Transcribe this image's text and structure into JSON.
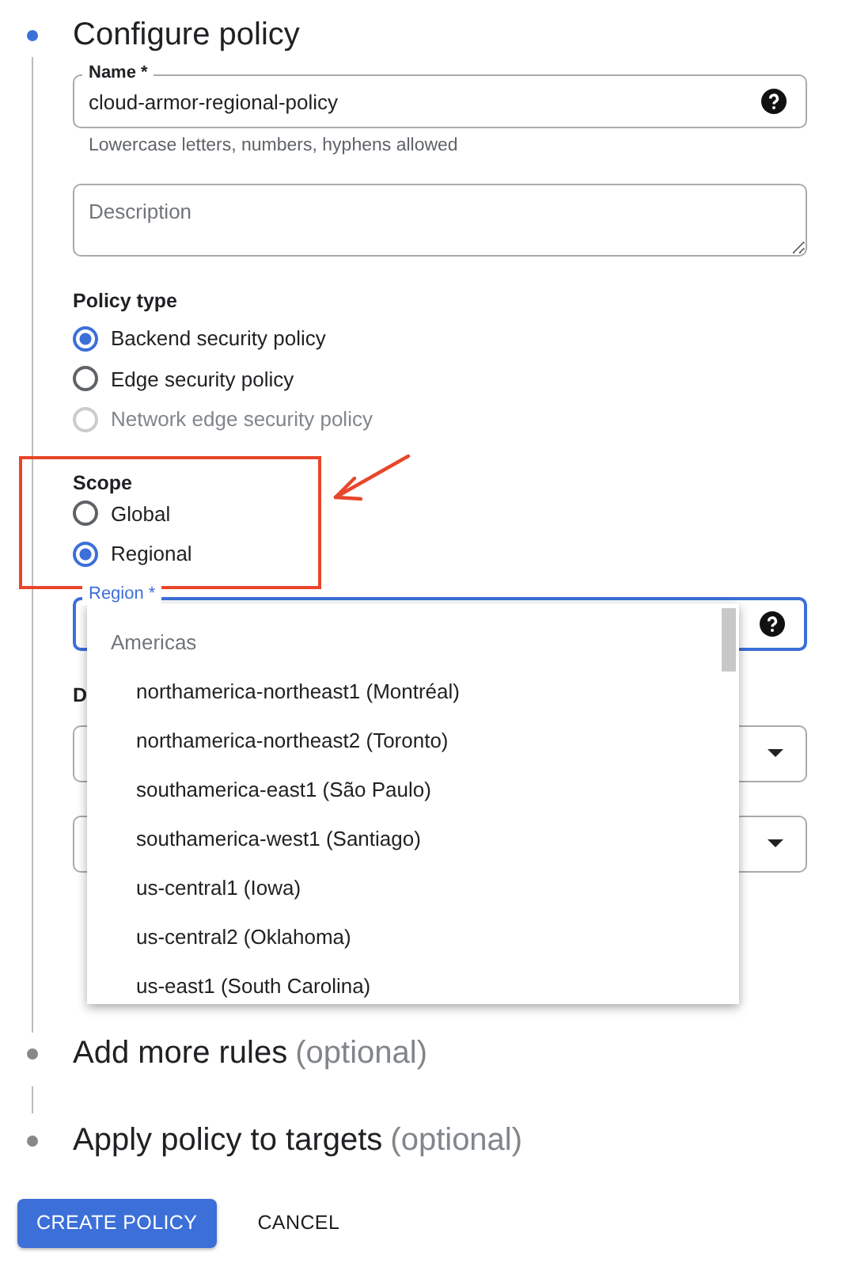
{
  "steps": [
    {
      "title": "Configure policy",
      "active": true
    },
    {
      "title": "Add more rules",
      "optional": "(optional)",
      "active": false
    },
    {
      "title": "Apply policy to targets",
      "optional": "(optional)",
      "active": false
    }
  ],
  "name_field": {
    "label": "Name *",
    "value": "cloud-armor-regional-policy",
    "helper": "Lowercase letters, numbers, hyphens allowed"
  },
  "description_field": {
    "placeholder": "Description"
  },
  "policy_type": {
    "label": "Policy type",
    "options": [
      {
        "label": "Backend security policy",
        "selected": true,
        "disabled": false
      },
      {
        "label": "Edge security policy",
        "selected": false,
        "disabled": false
      },
      {
        "label": "Network edge security policy",
        "selected": false,
        "disabled": true
      }
    ]
  },
  "scope": {
    "label": "Scope",
    "options": [
      {
        "label": "Global",
        "selected": false,
        "disabled": false
      },
      {
        "label": "Regional",
        "selected": true,
        "disabled": false
      }
    ]
  },
  "region_field": {
    "label": "Region *",
    "focused": true
  },
  "hidden_label": "D",
  "region_menu": {
    "group": "Americas",
    "items": [
      "northamerica-northeast1 (Montréal)",
      "northamerica-northeast2 (Toronto)",
      "southamerica-east1 (São Paulo)",
      "southamerica-west1 (Santiago)",
      "us-central1 (Iowa)",
      "us-central2 (Oklahoma)",
      "us-east1 (South Carolina)"
    ]
  },
  "buttons": [
    {
      "label": "CREATE POLICY",
      "kind": "primary"
    },
    {
      "label": "CANCEL",
      "kind": "text"
    }
  ]
}
